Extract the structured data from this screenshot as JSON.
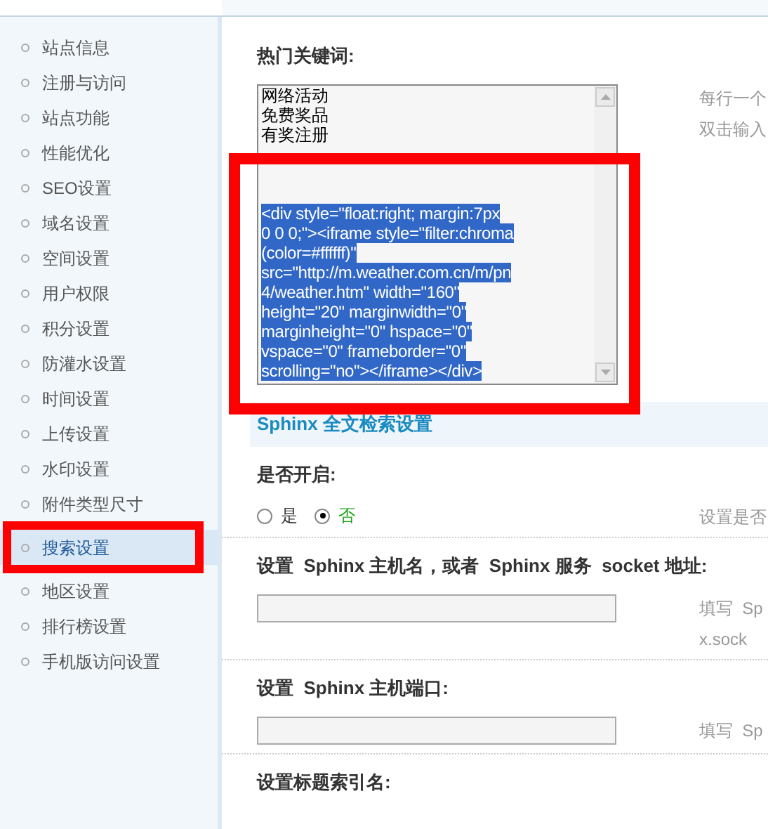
{
  "sidebar": {
    "items": [
      {
        "label": "站点信息",
        "selected": false,
        "annotated": false
      },
      {
        "label": "注册与访问",
        "selected": false,
        "annotated": false
      },
      {
        "label": "站点功能",
        "selected": false,
        "annotated": false
      },
      {
        "label": "性能优化",
        "selected": false,
        "annotated": false
      },
      {
        "label": "SEO设置",
        "selected": false,
        "annotated": false
      },
      {
        "label": "域名设置",
        "selected": false,
        "annotated": false
      },
      {
        "label": "空间设置",
        "selected": false,
        "annotated": false
      },
      {
        "label": "用户权限",
        "selected": false,
        "annotated": false
      },
      {
        "label": "积分设置",
        "selected": false,
        "annotated": false
      },
      {
        "label": "防灌水设置",
        "selected": false,
        "annotated": false
      },
      {
        "label": "时间设置",
        "selected": false,
        "annotated": false
      },
      {
        "label": "上传设置",
        "selected": false,
        "annotated": false
      },
      {
        "label": "水印设置",
        "selected": false,
        "annotated": false
      },
      {
        "label": "附件类型尺寸",
        "selected": false,
        "annotated": false
      },
      {
        "label": "搜索设置",
        "selected": true,
        "annotated": true
      },
      {
        "label": "地区设置",
        "selected": false,
        "annotated": false
      },
      {
        "label": "排行榜设置",
        "selected": false,
        "annotated": false
      },
      {
        "label": "手机版访问设置",
        "selected": false,
        "annotated": false
      }
    ]
  },
  "keywords": {
    "label": "热门关键词:",
    "lines": [
      "网络活动",
      "免费奖品",
      "有奖注册"
    ],
    "selected_lines": [
      "<div style=\"float:right; margin:7px",
      "0 0 0;\"><iframe style=\"filter:chroma",
      "(color=#ffffff)\"",
      "src=\"http://m.weather.com.cn/m/pn",
      "4/weather.htm\" width=\"160\"",
      "height=\"20\" marginwidth=\"0\"",
      "marginheight=\"0\" hspace=\"0\"",
      "vspace=\"0\" frameborder=\"0\"",
      "scrolling=\"no\"></iframe></div>"
    ],
    "hints": [
      "每行一个",
      "双击输入"
    ],
    "annotated": true
  },
  "section_title": "Sphinx 全文检索设置",
  "settings": [
    {
      "kind": "radio",
      "label": "是否开启:",
      "options": [
        {
          "label": "是",
          "selected": false
        },
        {
          "label": "否",
          "selected": true
        }
      ],
      "hints": [
        "设置是否"
      ]
    },
    {
      "kind": "input",
      "label": "设置  Sphinx 主机名，或者  Sphinx 服务  socket 地址:",
      "hints": [
        "填写  Sp",
        "x.sock"
      ]
    },
    {
      "kind": "input",
      "label": "设置  Sphinx 主机端口:",
      "hints": [
        "填写  Sp"
      ]
    },
    {
      "kind": "heading",
      "label": "设置标题索引名:"
    }
  ]
}
